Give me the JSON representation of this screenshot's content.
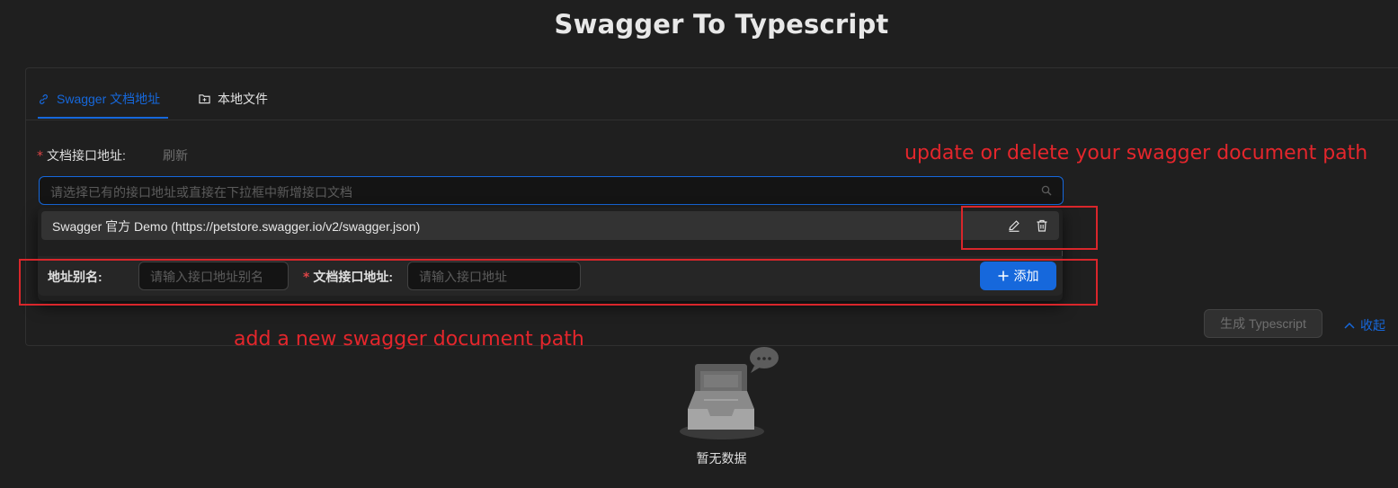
{
  "header": {
    "title": "Swagger To Typescript"
  },
  "tabs": [
    {
      "label": "Swagger 文档地址",
      "icon": "link-icon",
      "active": true
    },
    {
      "label": "本地文件",
      "icon": "folder-icon",
      "active": false
    }
  ],
  "form": {
    "required_mark": "*",
    "doc_url_label": "文档接口地址:",
    "refresh_label": "刷新",
    "select_placeholder": "请选择已有的接口地址或直接在下拉框中新增接口文档"
  },
  "dropdown": {
    "options": [
      {
        "label": "Swagger 官方 Demo (https://petstore.swagger.io/v2/swagger.json)"
      }
    ],
    "add_row": {
      "alias_label": "地址别名:",
      "alias_placeholder": "请输入接口地址别名",
      "url_label": "文档接口地址:",
      "url_placeholder": "请输入接口地址",
      "add_button": "添加"
    }
  },
  "actions": {
    "generate_button": "生成 Typescript",
    "collapse_link": "收起"
  },
  "annotations": {
    "update_delete": "update or delete your swagger document path",
    "add_new": "add a new swagger document path"
  },
  "empty": {
    "text": "暂无数据"
  },
  "colors": {
    "background": "#1f1f1f",
    "primary": "#1668dc",
    "annotation_red": "#e4262c",
    "required_red": "#dc4446"
  }
}
